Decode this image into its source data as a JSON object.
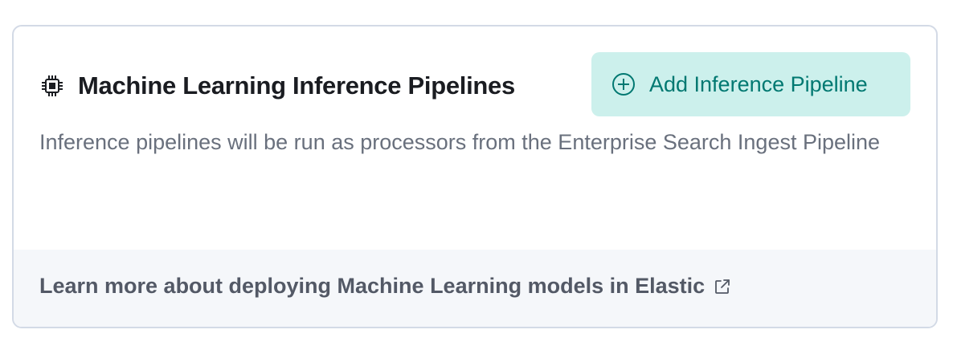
{
  "panel": {
    "title": "Machine Learning Inference Pipelines",
    "title_icon": "compute-chip-icon",
    "add_button": {
      "label": "Add Inference Pipeline",
      "icon": "plus-in-circle-icon"
    },
    "description": "Inference pipelines will be run as processors from the Enterprise Search Ingest Pipeline",
    "footer": {
      "link_label": "Learn more about deploying Machine Learning models in Elastic",
      "link_icon": "external-link-icon"
    }
  },
  "colors": {
    "title_text": "#1a1c21",
    "body_text": "#69707d",
    "button_bg": "#ccf0ec",
    "button_text": "#007871",
    "footer_bg": "#f5f7fa",
    "footer_text": "#535966",
    "border": "#d3dae6"
  }
}
